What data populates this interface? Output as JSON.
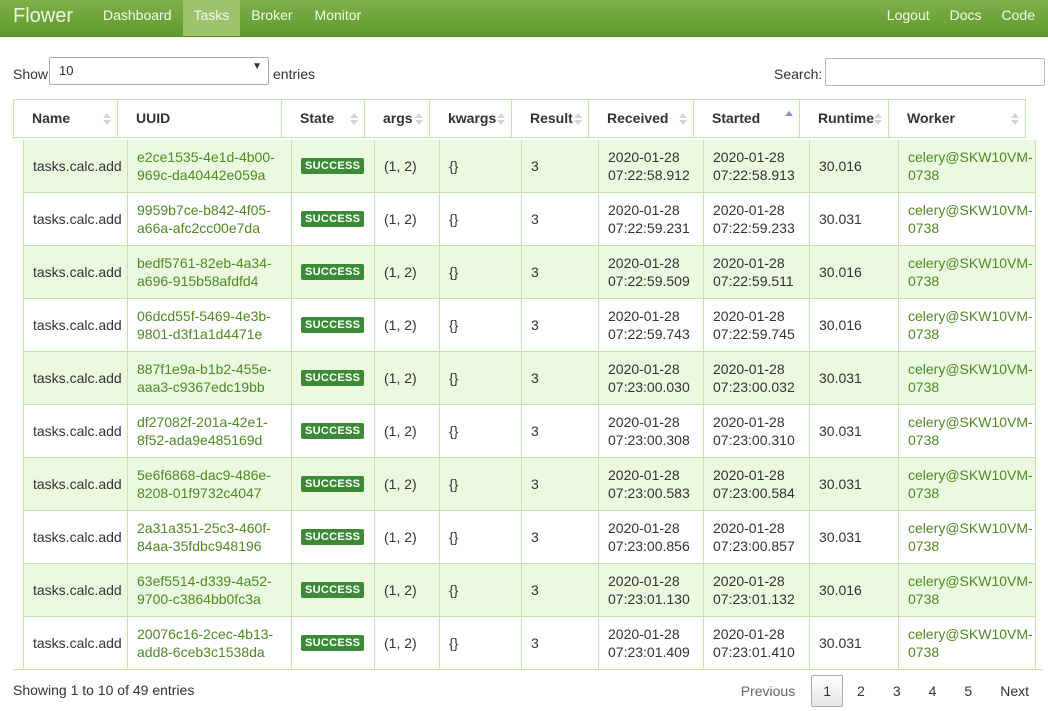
{
  "nav": {
    "brand": "Flower",
    "left": [
      "Dashboard",
      "Tasks",
      "Broker",
      "Monitor"
    ],
    "active": "Tasks",
    "right": [
      "Logout",
      "Docs",
      "Code"
    ]
  },
  "controls": {
    "show_label": "Show",
    "length_value": "10",
    "entries_label": "entries",
    "search_label": "Search:",
    "search_value": ""
  },
  "table": {
    "columns": [
      "Name",
      "UUID",
      "State",
      "args",
      "kwargs",
      "Result",
      "Received",
      "Started",
      "Runtime",
      "Worker"
    ],
    "sorted_column": "Started",
    "sort_direction": "ascending",
    "rows": [
      {
        "name": "tasks.calc.add",
        "uuid": [
          "e2ce1535-4e1d-4b00-",
          "969c-da40442e059a"
        ],
        "state": "SUCCESS",
        "args": "(1, 2)",
        "kwargs": "{}",
        "result": "3",
        "received": [
          "2020-01-28",
          "07:22:58.912"
        ],
        "started": [
          "2020-01-28",
          "07:22:58.913"
        ],
        "runtime": "30.016",
        "worker": [
          "celery@SKW10VM-",
          "0738"
        ]
      },
      {
        "name": "tasks.calc.add",
        "uuid": [
          "9959b7ce-b842-4f05-",
          "a66a-afc2cc00e7da"
        ],
        "state": "SUCCESS",
        "args": "(1, 2)",
        "kwargs": "{}",
        "result": "3",
        "received": [
          "2020-01-28",
          "07:22:59.231"
        ],
        "started": [
          "2020-01-28",
          "07:22:59.233"
        ],
        "runtime": "30.031",
        "worker": [
          "celery@SKW10VM-",
          "0738"
        ]
      },
      {
        "name": "tasks.calc.add",
        "uuid": [
          "bedf5761-82eb-4a34-",
          "a696-915b58afdfd4"
        ],
        "state": "SUCCESS",
        "args": "(1, 2)",
        "kwargs": "{}",
        "result": "3",
        "received": [
          "2020-01-28",
          "07:22:59.509"
        ],
        "started": [
          "2020-01-28",
          "07:22:59.511"
        ],
        "runtime": "30.016",
        "worker": [
          "celery@SKW10VM-",
          "0738"
        ]
      },
      {
        "name": "tasks.calc.add",
        "uuid": [
          "06dcd55f-5469-4e3b-",
          "9801-d3f1a1d4471e"
        ],
        "state": "SUCCESS",
        "args": "(1, 2)",
        "kwargs": "{}",
        "result": "3",
        "received": [
          "2020-01-28",
          "07:22:59.743"
        ],
        "started": [
          "2020-01-28",
          "07:22:59.745"
        ],
        "runtime": "30.016",
        "worker": [
          "celery@SKW10VM-",
          "0738"
        ]
      },
      {
        "name": "tasks.calc.add",
        "uuid": [
          "887f1e9a-b1b2-455e-",
          "aaa3-c9367edc19bb"
        ],
        "state": "SUCCESS",
        "args": "(1, 2)",
        "kwargs": "{}",
        "result": "3",
        "received": [
          "2020-01-28",
          "07:23:00.030"
        ],
        "started": [
          "2020-01-28",
          "07:23:00.032"
        ],
        "runtime": "30.031",
        "worker": [
          "celery@SKW10VM-",
          "0738"
        ]
      },
      {
        "name": "tasks.calc.add",
        "uuid": [
          "df27082f-201a-42e1-",
          "8f52-ada9e485169d"
        ],
        "state": "SUCCESS",
        "args": "(1, 2)",
        "kwargs": "{}",
        "result": "3",
        "received": [
          "2020-01-28",
          "07:23:00.308"
        ],
        "started": [
          "2020-01-28",
          "07:23:00.310"
        ],
        "runtime": "30.031",
        "worker": [
          "celery@SKW10VM-",
          "0738"
        ]
      },
      {
        "name": "tasks.calc.add",
        "uuid": [
          "5e6f6868-dac9-486e-",
          "8208-01f9732c4047"
        ],
        "state": "SUCCESS",
        "args": "(1, 2)",
        "kwargs": "{}",
        "result": "3",
        "received": [
          "2020-01-28",
          "07:23:00.583"
        ],
        "started": [
          "2020-01-28",
          "07:23:00.584"
        ],
        "runtime": "30.031",
        "worker": [
          "celery@SKW10VM-",
          "0738"
        ]
      },
      {
        "name": "tasks.calc.add",
        "uuid": [
          "2a31a351-25c3-460f-",
          "84aa-35fdbc948196"
        ],
        "state": "SUCCESS",
        "args": "(1, 2)",
        "kwargs": "{}",
        "result": "3",
        "received": [
          "2020-01-28",
          "07:23:00.856"
        ],
        "started": [
          "2020-01-28",
          "07:23:00.857"
        ],
        "runtime": "30.031",
        "worker": [
          "celery@SKW10VM-",
          "0738"
        ]
      },
      {
        "name": "tasks.calc.add",
        "uuid": [
          "63ef5514-d339-4a52-",
          "9700-c3864bb0fc3a"
        ],
        "state": "SUCCESS",
        "args": "(1, 2)",
        "kwargs": "{}",
        "result": "3",
        "received": [
          "2020-01-28",
          "07:23:01.130"
        ],
        "started": [
          "2020-01-28",
          "07:23:01.132"
        ],
        "runtime": "30.016",
        "worker": [
          "celery@SKW10VM-",
          "0738"
        ]
      },
      {
        "name": "tasks.calc.add",
        "uuid": [
          "20076c16-2cec-4b13-",
          "add8-6ceb3c1538da"
        ],
        "state": "SUCCESS",
        "args": "(1, 2)",
        "kwargs": "{}",
        "result": "3",
        "received": [
          "2020-01-28",
          "07:23:01.409"
        ],
        "started": [
          "2020-01-28",
          "07:23:01.410"
        ],
        "runtime": "30.031",
        "worker": [
          "celery@SKW10VM-",
          "0738"
        ]
      }
    ]
  },
  "footer": {
    "info": "Showing 1 to 10 of 49 entries",
    "previous": "Previous",
    "pages": [
      "1",
      "2",
      "3",
      "4",
      "5"
    ],
    "current_page": "1",
    "next": "Next"
  },
  "colors": {
    "navbar": "#6aa33a",
    "link_green": "#4f8a22",
    "success_badge": "#3c8a37",
    "odd_row": "#eaf9df",
    "border": "#c6e4ac"
  }
}
